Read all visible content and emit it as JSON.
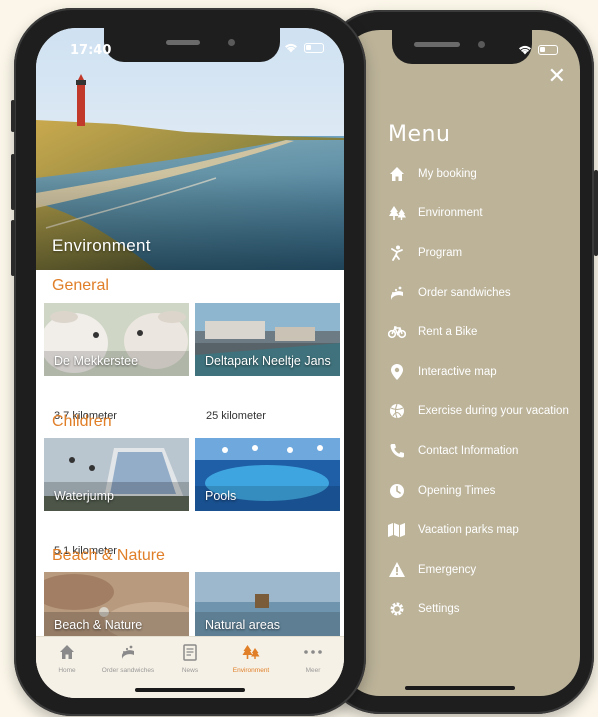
{
  "left_phone": {
    "status_time": "17:40",
    "hero_title": "Environment",
    "sections": [
      {
        "title": "General",
        "cards": [
          {
            "label": "De Mekkerstee",
            "distance": "3.7 kilometer"
          },
          {
            "label": "Deltapark Neeltje Jans",
            "distance": "25 kilometer"
          }
        ]
      },
      {
        "title": "Children",
        "cards": [
          {
            "label": "Waterjump",
            "distance": "5.1 kilometer"
          },
          {
            "label": "Pools",
            "distance": ""
          }
        ]
      },
      {
        "title": "Beach & Nature",
        "cards": [
          {
            "label": "Beach & Nature",
            "distance": ""
          },
          {
            "label": "Natural areas",
            "distance": ""
          }
        ]
      }
    ],
    "tabs": [
      {
        "label": "Home",
        "icon": "home-icon"
      },
      {
        "label": "Order sandwiches",
        "icon": "sandwich-icon"
      },
      {
        "label": "News",
        "icon": "newspaper-icon"
      },
      {
        "label": "Environment",
        "icon": "trees-icon",
        "active": true
      },
      {
        "label": "Meer",
        "icon": "more-icon"
      }
    ]
  },
  "right_phone": {
    "menu_title": "Menu",
    "close_icon": "close-icon",
    "items": [
      {
        "label": "My booking",
        "icon": "home-icon"
      },
      {
        "label": "Environment",
        "icon": "trees-icon"
      },
      {
        "label": "Program",
        "icon": "person-jumping-icon"
      },
      {
        "label": "Order sandwiches",
        "icon": "sandwich-icon"
      },
      {
        "label": "Rent a Bike",
        "icon": "bike-icon"
      },
      {
        "label": "Interactive map",
        "icon": "map-pin-icon"
      },
      {
        "label": "Exercise during your vacation",
        "icon": "ball-icon"
      },
      {
        "label": "Contact Information",
        "icon": "phone-icon"
      },
      {
        "label": "Opening Times",
        "icon": "clock-icon"
      },
      {
        "label": "Vacation parks map",
        "icon": "map-icon"
      },
      {
        "label": "Emergency",
        "icon": "warning-icon"
      },
      {
        "label": "Settings",
        "icon": "gear-icon"
      }
    ]
  },
  "colors": {
    "accent": "#e07f28",
    "menu_bg": "#bcb399",
    "page_bg": "#fbf6e9",
    "tabbar_bg": "#f6f1e6"
  }
}
